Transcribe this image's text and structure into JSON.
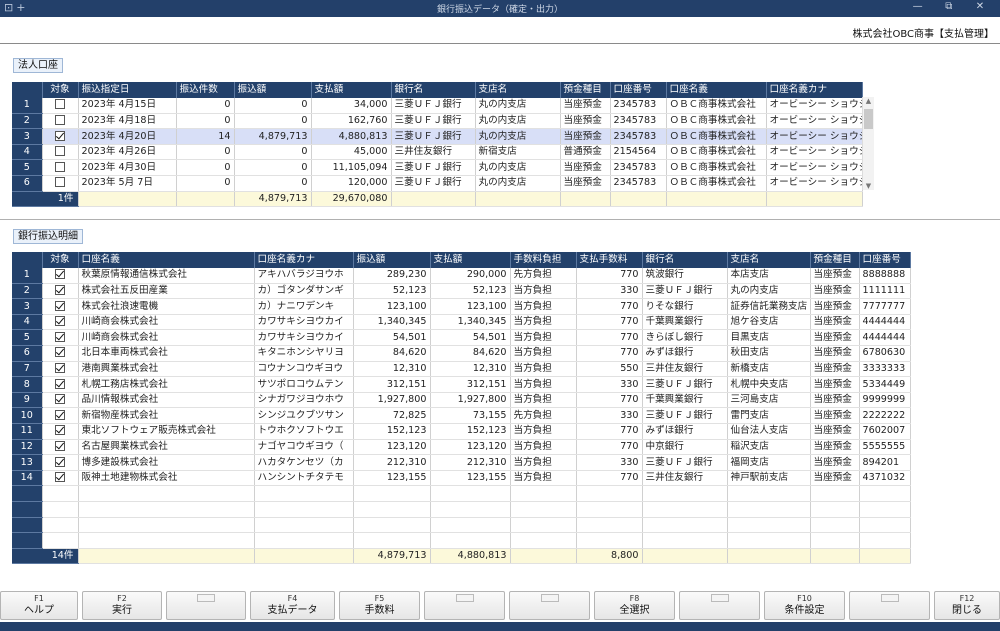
{
  "window": {
    "title": "銀行振込データ（確定・出力）",
    "left_icons": "⊡+",
    "controls": [
      "—",
      "⧉",
      "✕"
    ]
  },
  "company": "株式会社OBC商事【支払管理】",
  "account_section": {
    "label": "法人口座",
    "columns": [
      "",
      "対象",
      "振込指定日",
      "振込件数",
      "振込額",
      "支払額",
      "銀行名",
      "支店名",
      "預金種目",
      "口座番号",
      "口座名義",
      "口座名義カナ"
    ],
    "rows": [
      {
        "no": "1",
        "checked": false,
        "date": "2023年 4月15日",
        "count": "0",
        "transfer": "0",
        "payment": "34,000",
        "bank": "三菱ＵＦＪ銀行",
        "branch": "丸の内支店",
        "type": "当座預金",
        "acct": "2345783",
        "holder": "ＯＢＣ商事株式会社",
        "kana": "オービーシー ショウジ"
      },
      {
        "no": "2",
        "checked": false,
        "date": "2023年 4月18日",
        "count": "0",
        "transfer": "0",
        "payment": "162,760",
        "bank": "三菱ＵＦＪ銀行",
        "branch": "丸の内支店",
        "type": "当座預金",
        "acct": "2345783",
        "holder": "ＯＢＣ商事株式会社",
        "kana": "オービーシー ショウジ"
      },
      {
        "no": "3",
        "checked": true,
        "date": "2023年 4月20日",
        "count": "14",
        "transfer": "4,879,713",
        "payment": "4,880,813",
        "bank": "三菱ＵＦＪ銀行",
        "branch": "丸の内支店",
        "type": "当座預金",
        "acct": "2345783",
        "holder": "ＯＢＣ商事株式会社",
        "kana": "オービーシー ショウジ"
      },
      {
        "no": "4",
        "checked": false,
        "date": "2023年 4月26日",
        "count": "0",
        "transfer": "0",
        "payment": "45,000",
        "bank": "三井住友銀行",
        "branch": "新宿支店",
        "type": "普通預金",
        "acct": "2154564",
        "holder": "ＯＢＣ商事株式会社",
        "kana": "オービーシー ショウジ"
      },
      {
        "no": "5",
        "checked": false,
        "date": "2023年 4月30日",
        "count": "0",
        "transfer": "0",
        "payment": "11,105,094",
        "bank": "三菱ＵＦＪ銀行",
        "branch": "丸の内支店",
        "type": "当座預金",
        "acct": "2345783",
        "holder": "ＯＢＣ商事株式会社",
        "kana": "オービーシー ショウジ"
      },
      {
        "no": "6",
        "checked": false,
        "date": "2023年 5月 7日",
        "count": "0",
        "transfer": "0",
        "payment": "120,000",
        "bank": "三菱ＵＦＪ銀行",
        "branch": "丸の内支店",
        "type": "当座預金",
        "acct": "2345783",
        "holder": "ＯＢＣ商事株式会社",
        "kana": "オービーシー ショウジ"
      }
    ],
    "footer": {
      "count": "1件",
      "transfer": "4,879,713",
      "payment": "29,670,080"
    }
  },
  "detail_section": {
    "label": "銀行振込明細",
    "columns": [
      "",
      "対象",
      "口座名義",
      "口座名義カナ",
      "振込額",
      "支払額",
      "手数料負担",
      "支払手数料",
      "銀行名",
      "支店名",
      "預金種目",
      "口座番号"
    ],
    "rows": [
      {
        "no": "1",
        "checked": true,
        "holder": "秋葉原情報通信株式会社",
        "kana": "アキハバラジヨウホ",
        "transfer": "289,230",
        "payment": "290,000",
        "burden": "先方負担",
        "fee": "770",
        "bank": "筑波銀行",
        "branch": "本店支店",
        "type": "当座預金",
        "acct": "8888888"
      },
      {
        "no": "2",
        "checked": true,
        "holder": "株式会社五反田産業",
        "kana": "カ）ゴタンダサンギ",
        "transfer": "52,123",
        "payment": "52,123",
        "burden": "当方負担",
        "fee": "330",
        "bank": "三菱ＵＦＪ銀行",
        "branch": "丸の内支店",
        "type": "当座預金",
        "acct": "1111111"
      },
      {
        "no": "3",
        "checked": true,
        "holder": "株式会社浪速電機",
        "kana": "カ）ナニワデンキ",
        "transfer": "123,100",
        "payment": "123,100",
        "burden": "当方負担",
        "fee": "770",
        "bank": "りそな銀行",
        "branch": "証券信託業務支店",
        "type": "当座預金",
        "acct": "7777777"
      },
      {
        "no": "4",
        "checked": true,
        "holder": "川崎商会株式会社",
        "kana": "カワサキシヨウカイ",
        "transfer": "1,340,345",
        "payment": "1,340,345",
        "burden": "当方負担",
        "fee": "770",
        "bank": "千葉興業銀行",
        "branch": "旭ケ谷支店",
        "type": "当座預金",
        "acct": "4444444"
      },
      {
        "no": "5",
        "checked": true,
        "holder": "川崎商会株式会社",
        "kana": "カワサキシヨウカイ",
        "transfer": "54,501",
        "payment": "54,501",
        "burden": "当方負担",
        "fee": "770",
        "bank": "きらぼし銀行",
        "branch": "目黒支店",
        "type": "当座預金",
        "acct": "4444444"
      },
      {
        "no": "6",
        "checked": true,
        "holder": "北日本車両株式会社",
        "kana": "キタニホンシヤリヨ",
        "transfer": "84,620",
        "payment": "84,620",
        "burden": "当方負担",
        "fee": "770",
        "bank": "みずほ銀行",
        "branch": "秋田支店",
        "type": "当座預金",
        "acct": "6780630"
      },
      {
        "no": "7",
        "checked": true,
        "holder": "港南興業株式会社",
        "kana": "コウナンコウギヨウ",
        "transfer": "12,310",
        "payment": "12,310",
        "burden": "当方負担",
        "fee": "550",
        "bank": "三井住友銀行",
        "branch": "新橋支店",
        "type": "当座預金",
        "acct": "3333333"
      },
      {
        "no": "8",
        "checked": true,
        "holder": "札幌工務店株式会社",
        "kana": "サツポロコウムテン",
        "transfer": "312,151",
        "payment": "312,151",
        "burden": "当方負担",
        "fee": "330",
        "bank": "三菱ＵＦＪ銀行",
        "branch": "札幌中央支店",
        "type": "当座預金",
        "acct": "5334449"
      },
      {
        "no": "9",
        "checked": true,
        "holder": "品川情報株式会社",
        "kana": "シナガワジヨウホウ",
        "transfer": "1,927,800",
        "payment": "1,927,800",
        "burden": "当方負担",
        "fee": "770",
        "bank": "千葉興業銀行",
        "branch": "三河島支店",
        "type": "当座預金",
        "acct": "9999999"
      },
      {
        "no": "10",
        "checked": true,
        "holder": "新宿物産株式会社",
        "kana": "シンジユクブツサン",
        "transfer": "72,825",
        "payment": "73,155",
        "burden": "先方負担",
        "fee": "330",
        "bank": "三菱ＵＦＪ銀行",
        "branch": "雷門支店",
        "type": "当座預金",
        "acct": "2222222"
      },
      {
        "no": "11",
        "checked": true,
        "holder": "東北ソフトウェア販売株式会社",
        "kana": "トウホクソフトウエ",
        "transfer": "152,123",
        "payment": "152,123",
        "burden": "当方負担",
        "fee": "770",
        "bank": "みずほ銀行",
        "branch": "仙台法人支店",
        "type": "当座預金",
        "acct": "7602007"
      },
      {
        "no": "12",
        "checked": true,
        "holder": "名古屋興業株式会社",
        "kana": "ナゴヤコウギヨウ（",
        "transfer": "123,120",
        "payment": "123,120",
        "burden": "当方負担",
        "fee": "770",
        "bank": "中京銀行",
        "branch": "稲沢支店",
        "type": "当座預金",
        "acct": "5555555"
      },
      {
        "no": "13",
        "checked": true,
        "holder": "博多建設株式会社",
        "kana": "ハカタケンセツ（カ",
        "transfer": "212,310",
        "payment": "212,310",
        "burden": "当方負担",
        "fee": "330",
        "bank": "三菱ＵＦＪ銀行",
        "branch": "福岡支店",
        "type": "当座預金",
        "acct": "894201"
      },
      {
        "no": "14",
        "checked": true,
        "holder": "阪神土地建物株式会社",
        "kana": "ハンシントチタテモ",
        "transfer": "123,155",
        "payment": "123,155",
        "burden": "当方負担",
        "fee": "770",
        "bank": "三井住友銀行",
        "branch": "神戸駅前支店",
        "type": "当座預金",
        "acct": "4371032"
      }
    ],
    "empty_rows": 4,
    "footer": {
      "count": "14件",
      "transfer": "4,879,713",
      "payment": "4,880,813",
      "fee": "8,800"
    }
  },
  "function_keys": [
    {
      "key": "F1",
      "label": "ヘルプ"
    },
    {
      "key": "F2",
      "label": "実行"
    },
    {
      "key": "",
      "label": ""
    },
    {
      "key": "F4",
      "label": "支払データ"
    },
    {
      "key": "F5",
      "label": "手数料"
    },
    {
      "key": "",
      "label": ""
    },
    {
      "key": "",
      "label": ""
    },
    {
      "key": "F8",
      "label": "全選択"
    },
    {
      "key": "",
      "label": ""
    },
    {
      "key": "F10",
      "label": "条件設定"
    },
    {
      "key": "",
      "label": ""
    },
    {
      "key": "F12",
      "label": "閉じる"
    }
  ]
}
